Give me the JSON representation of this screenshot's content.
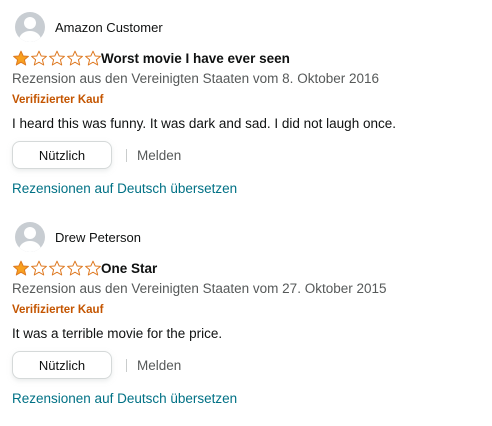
{
  "colors": {
    "star_fill": "#f8a120",
    "star_outline": "#de7921",
    "verified": "#c45500",
    "link": "#007185",
    "muted": "#565959"
  },
  "reviews": [
    {
      "author": "Amazon Customer",
      "rating": 1,
      "rating_max": 5,
      "title": "Worst movie I have ever seen",
      "meta": "Rezension aus den Vereinigten Staaten vom 8. Oktober 2016",
      "verified": "Verifizierter Kauf",
      "body": "I heard this was funny. It was dark and sad. I did not laugh once.",
      "helpful_label": "Nützlich",
      "report_label": "Melden",
      "translate_label": "Rezensionen auf Deutsch übersetzen"
    },
    {
      "author": "Drew Peterson",
      "rating": 1,
      "rating_max": 5,
      "title": "One Star",
      "meta": "Rezension aus den Vereinigten Staaten vom 27. Oktober 2015",
      "verified": "Verifizierter Kauf",
      "body": "It was a terrible movie for the price.",
      "helpful_label": "Nützlich",
      "report_label": "Melden",
      "translate_label": "Rezensionen auf Deutsch übersetzen"
    }
  ]
}
